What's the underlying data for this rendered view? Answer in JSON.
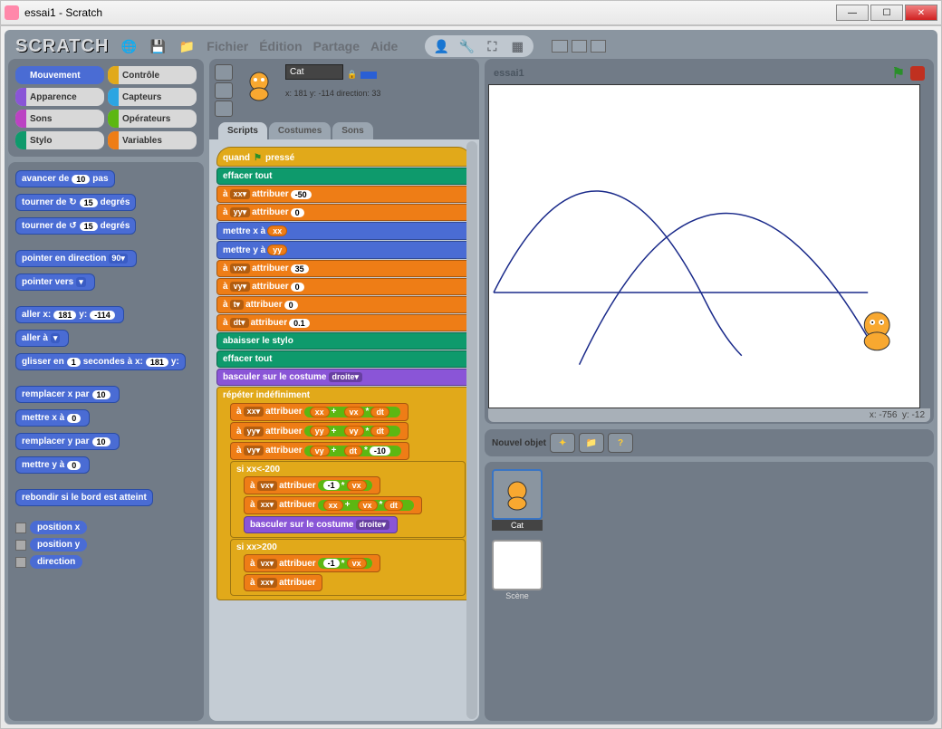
{
  "window": {
    "title": "essai1 - Scratch"
  },
  "menubar": {
    "logo": "SCRATCH",
    "items": [
      "Fichier",
      "Édition",
      "Partage",
      "Aide"
    ]
  },
  "categories": [
    {
      "name": "Mouvement",
      "cls": "cat-mouvement",
      "active": true
    },
    {
      "name": "Contrôle",
      "cls": "cat-controle"
    },
    {
      "name": "Apparence",
      "cls": "cat-apparence"
    },
    {
      "name": "Capteurs",
      "cls": "cat-capteurs"
    },
    {
      "name": "Sons",
      "cls": "cat-sons"
    },
    {
      "name": "Opérateurs",
      "cls": "cat-operateurs"
    },
    {
      "name": "Stylo",
      "cls": "cat-stylo"
    },
    {
      "name": "Variables",
      "cls": "cat-variables"
    }
  ],
  "palette": {
    "avancer": {
      "pre": "avancer de",
      "v": "10",
      "post": "pas"
    },
    "tourner_cw": {
      "pre": "tourner de ↻",
      "v": "15",
      "post": "degrés"
    },
    "tourner_ccw": {
      "pre": "tourner de ↺",
      "v": "15",
      "post": "degrés"
    },
    "pointer_dir": {
      "pre": "pointer en direction",
      "v": "90▾"
    },
    "pointer_vers": {
      "pre": "pointer vers",
      "v": "▾"
    },
    "goto_xy": {
      "pre": "aller x:",
      "x": "181",
      "mid": "y:",
      "y": "-114"
    },
    "goto": {
      "pre": "aller à",
      "v": "▾"
    },
    "glisser": {
      "pre": "glisser en",
      "s": "1",
      "mid": "secondes à x:",
      "x": "181",
      "mid2": "y:"
    },
    "set_x_by": {
      "pre": "remplacer x par",
      "v": "10"
    },
    "set_x": {
      "pre": "mettre x à",
      "v": "0"
    },
    "set_y_by": {
      "pre": "remplacer y par",
      "v": "10"
    },
    "set_y": {
      "pre": "mettre y à",
      "v": "0"
    },
    "bounce": "rebondir si le bord est atteint",
    "report_x": "position x",
    "report_y": "position y",
    "report_dir": "direction"
  },
  "sprite": {
    "name": "Cat",
    "coords": "x: 181  y: -114 direction: 33"
  },
  "tabs": {
    "scripts": "Scripts",
    "costumes": "Costumes",
    "sons": "Sons"
  },
  "script": {
    "hat": {
      "pre": "quand",
      "post": "pressé"
    },
    "clear1": "effacer tout",
    "set_xx": {
      "pre": "à",
      "var": "xx▾",
      "mid": "attribuer",
      "v": "-50"
    },
    "set_yy": {
      "pre": "à",
      "var": "yy▾",
      "mid": "attribuer",
      "v": "0"
    },
    "mettre_x": {
      "pre": "mettre x à",
      "var": "xx"
    },
    "mettre_y": {
      "pre": "mettre y à",
      "var": "yy"
    },
    "set_vx": {
      "pre": "à",
      "var": "vx▾",
      "mid": "attribuer",
      "v": "35"
    },
    "set_vy": {
      "pre": "à",
      "var": "vy▾",
      "mid": "attribuer",
      "v": "0"
    },
    "set_t": {
      "pre": "à",
      "var": "t▾",
      "mid": "attribuer",
      "v": "0"
    },
    "set_dt": {
      "pre": "à",
      "var": "dt▾",
      "mid": "attribuer",
      "v": "0.1"
    },
    "pendown": "abaisser le stylo",
    "clear2": "effacer tout",
    "costume": {
      "pre": "basculer sur le costume",
      "v": "droite▾"
    },
    "forever": "répéter indéfiniment",
    "upd_xx": {
      "pre": "à",
      "var": "xx▾",
      "mid": "attribuer",
      "a": "xx",
      "op": "+",
      "b1": "vx",
      "op2": "*",
      "b2": "dt"
    },
    "upd_yy": {
      "pre": "à",
      "var": "yy▾",
      "mid": "attribuer",
      "a": "yy",
      "op": "+",
      "b1": "vy",
      "op2": "*",
      "b2": "dt"
    },
    "upd_vy": {
      "pre": "à",
      "var": "vy▾",
      "mid": "attribuer",
      "a": "vy",
      "op": "+",
      "b1": "dt",
      "op2": "*",
      "b2": "-10"
    },
    "if1": {
      "pre": "si",
      "a": "xx",
      "op": "<",
      "b": "-200"
    },
    "rev_vx1": {
      "pre": "à",
      "var": "vx▾",
      "mid": "attribuer",
      "a": "-1",
      "op": "*",
      "b": "vx"
    },
    "upd_xx2": {
      "pre": "à",
      "var": "xx▾",
      "mid": "attribuer",
      "a": "xx",
      "op": "+",
      "b1": "vx",
      "op2": "*",
      "b2": "dt"
    },
    "costume2": {
      "pre": "basculer sur le costume",
      "v": "droite▾"
    },
    "if2": {
      "pre": "si",
      "a": "xx",
      "op": ">",
      "b": "200"
    },
    "rev_vx2": {
      "pre": "à",
      "var": "vx▾",
      "mid": "attribuer",
      "a": "-1",
      "op": "*",
      "b": "vx"
    },
    "upd_xx3_pre": {
      "pre": "à",
      "var": "xx▾",
      "mid": "attribuer"
    }
  },
  "stage": {
    "title": "essai1",
    "mouse": {
      "x": "-756",
      "y": "-12"
    },
    "new_sprite": "Nouvel objet",
    "scene_label": "Scène",
    "cat_label": "Cat"
  }
}
